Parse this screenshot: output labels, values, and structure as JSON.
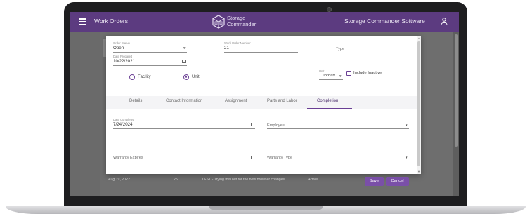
{
  "appbar": {
    "title": "Work Orders",
    "logo_line1": "Storage",
    "logo_line2": "Commander",
    "right_title": "Storage Commander Software",
    "menu_icon": "hamburger-menu-icon",
    "user_icon": "user-icon"
  },
  "colors": {
    "brand": "#5c3b80",
    "accent": "#7a4fa8"
  },
  "background_row": {
    "date": "Aug 19, 2022",
    "number": "25",
    "description": "TEST - Trying this out for the new browser changes",
    "status": "Active"
  },
  "dialog": {
    "order_status": {
      "label": "Order Status",
      "value": "Open"
    },
    "work_order_number": {
      "label": "Work Order Number",
      "value": "21"
    },
    "type": {
      "placeholder": "Type"
    },
    "date_prepared": {
      "label": "Date Prepared",
      "value": "10/22/2021"
    },
    "radio_facility": "Facility",
    "radio_unit": "Unit",
    "unit": {
      "label": "Unit",
      "value": "1 Jordan"
    },
    "include_inactive": "Include Inactive",
    "tabs": [
      "Details",
      "Contact Information",
      "Assignment",
      "Parts and Labor",
      "Completion"
    ],
    "active_tab": "Completion",
    "date_completed": {
      "label": "Date Completed",
      "value": "7/24/2024"
    },
    "employee": {
      "placeholder": "Employee"
    },
    "warranty_expires": {
      "placeholder": "Warranty Expires"
    },
    "warranty_type": {
      "placeholder": "Warranty Type"
    },
    "save_label": "Save",
    "cancel_label": "Cancel"
  }
}
